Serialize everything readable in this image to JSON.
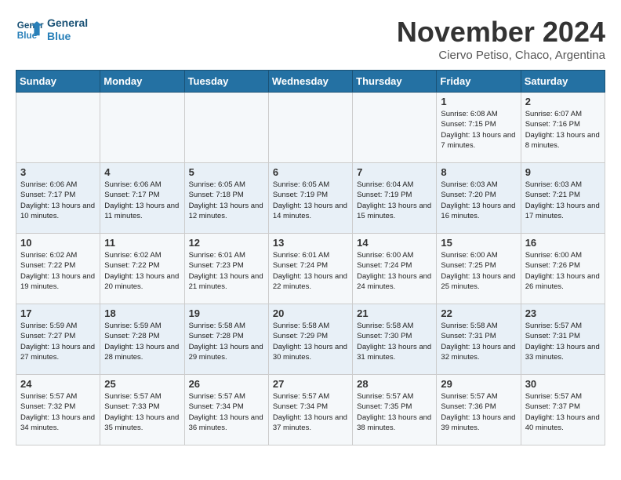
{
  "header": {
    "logo_line1": "General",
    "logo_line2": "Blue",
    "month_title": "November 2024",
    "location": "Ciervo Petiso, Chaco, Argentina"
  },
  "weekdays": [
    "Sunday",
    "Monday",
    "Tuesday",
    "Wednesday",
    "Thursday",
    "Friday",
    "Saturday"
  ],
  "weeks": [
    [
      {
        "day": "",
        "info": ""
      },
      {
        "day": "",
        "info": ""
      },
      {
        "day": "",
        "info": ""
      },
      {
        "day": "",
        "info": ""
      },
      {
        "day": "",
        "info": ""
      },
      {
        "day": "1",
        "info": "Sunrise: 6:08 AM\nSunset: 7:15 PM\nDaylight: 13 hours and 7 minutes."
      },
      {
        "day": "2",
        "info": "Sunrise: 6:07 AM\nSunset: 7:16 PM\nDaylight: 13 hours and 8 minutes."
      }
    ],
    [
      {
        "day": "3",
        "info": "Sunrise: 6:06 AM\nSunset: 7:17 PM\nDaylight: 13 hours and 10 minutes."
      },
      {
        "day": "4",
        "info": "Sunrise: 6:06 AM\nSunset: 7:17 PM\nDaylight: 13 hours and 11 minutes."
      },
      {
        "day": "5",
        "info": "Sunrise: 6:05 AM\nSunset: 7:18 PM\nDaylight: 13 hours and 12 minutes."
      },
      {
        "day": "6",
        "info": "Sunrise: 6:05 AM\nSunset: 7:19 PM\nDaylight: 13 hours and 14 minutes."
      },
      {
        "day": "7",
        "info": "Sunrise: 6:04 AM\nSunset: 7:19 PM\nDaylight: 13 hours and 15 minutes."
      },
      {
        "day": "8",
        "info": "Sunrise: 6:03 AM\nSunset: 7:20 PM\nDaylight: 13 hours and 16 minutes."
      },
      {
        "day": "9",
        "info": "Sunrise: 6:03 AM\nSunset: 7:21 PM\nDaylight: 13 hours and 17 minutes."
      }
    ],
    [
      {
        "day": "10",
        "info": "Sunrise: 6:02 AM\nSunset: 7:22 PM\nDaylight: 13 hours and 19 minutes."
      },
      {
        "day": "11",
        "info": "Sunrise: 6:02 AM\nSunset: 7:22 PM\nDaylight: 13 hours and 20 minutes."
      },
      {
        "day": "12",
        "info": "Sunrise: 6:01 AM\nSunset: 7:23 PM\nDaylight: 13 hours and 21 minutes."
      },
      {
        "day": "13",
        "info": "Sunrise: 6:01 AM\nSunset: 7:24 PM\nDaylight: 13 hours and 22 minutes."
      },
      {
        "day": "14",
        "info": "Sunrise: 6:00 AM\nSunset: 7:24 PM\nDaylight: 13 hours and 24 minutes."
      },
      {
        "day": "15",
        "info": "Sunrise: 6:00 AM\nSunset: 7:25 PM\nDaylight: 13 hours and 25 minutes."
      },
      {
        "day": "16",
        "info": "Sunrise: 6:00 AM\nSunset: 7:26 PM\nDaylight: 13 hours and 26 minutes."
      }
    ],
    [
      {
        "day": "17",
        "info": "Sunrise: 5:59 AM\nSunset: 7:27 PM\nDaylight: 13 hours and 27 minutes."
      },
      {
        "day": "18",
        "info": "Sunrise: 5:59 AM\nSunset: 7:28 PM\nDaylight: 13 hours and 28 minutes."
      },
      {
        "day": "19",
        "info": "Sunrise: 5:58 AM\nSunset: 7:28 PM\nDaylight: 13 hours and 29 minutes."
      },
      {
        "day": "20",
        "info": "Sunrise: 5:58 AM\nSunset: 7:29 PM\nDaylight: 13 hours and 30 minutes."
      },
      {
        "day": "21",
        "info": "Sunrise: 5:58 AM\nSunset: 7:30 PM\nDaylight: 13 hours and 31 minutes."
      },
      {
        "day": "22",
        "info": "Sunrise: 5:58 AM\nSunset: 7:31 PM\nDaylight: 13 hours and 32 minutes."
      },
      {
        "day": "23",
        "info": "Sunrise: 5:57 AM\nSunset: 7:31 PM\nDaylight: 13 hours and 33 minutes."
      }
    ],
    [
      {
        "day": "24",
        "info": "Sunrise: 5:57 AM\nSunset: 7:32 PM\nDaylight: 13 hours and 34 minutes."
      },
      {
        "day": "25",
        "info": "Sunrise: 5:57 AM\nSunset: 7:33 PM\nDaylight: 13 hours and 35 minutes."
      },
      {
        "day": "26",
        "info": "Sunrise: 5:57 AM\nSunset: 7:34 PM\nDaylight: 13 hours and 36 minutes."
      },
      {
        "day": "27",
        "info": "Sunrise: 5:57 AM\nSunset: 7:34 PM\nDaylight: 13 hours and 37 minutes."
      },
      {
        "day": "28",
        "info": "Sunrise: 5:57 AM\nSunset: 7:35 PM\nDaylight: 13 hours and 38 minutes."
      },
      {
        "day": "29",
        "info": "Sunrise: 5:57 AM\nSunset: 7:36 PM\nDaylight: 13 hours and 39 minutes."
      },
      {
        "day": "30",
        "info": "Sunrise: 5:57 AM\nSunset: 7:37 PM\nDaylight: 13 hours and 40 minutes."
      }
    ]
  ]
}
